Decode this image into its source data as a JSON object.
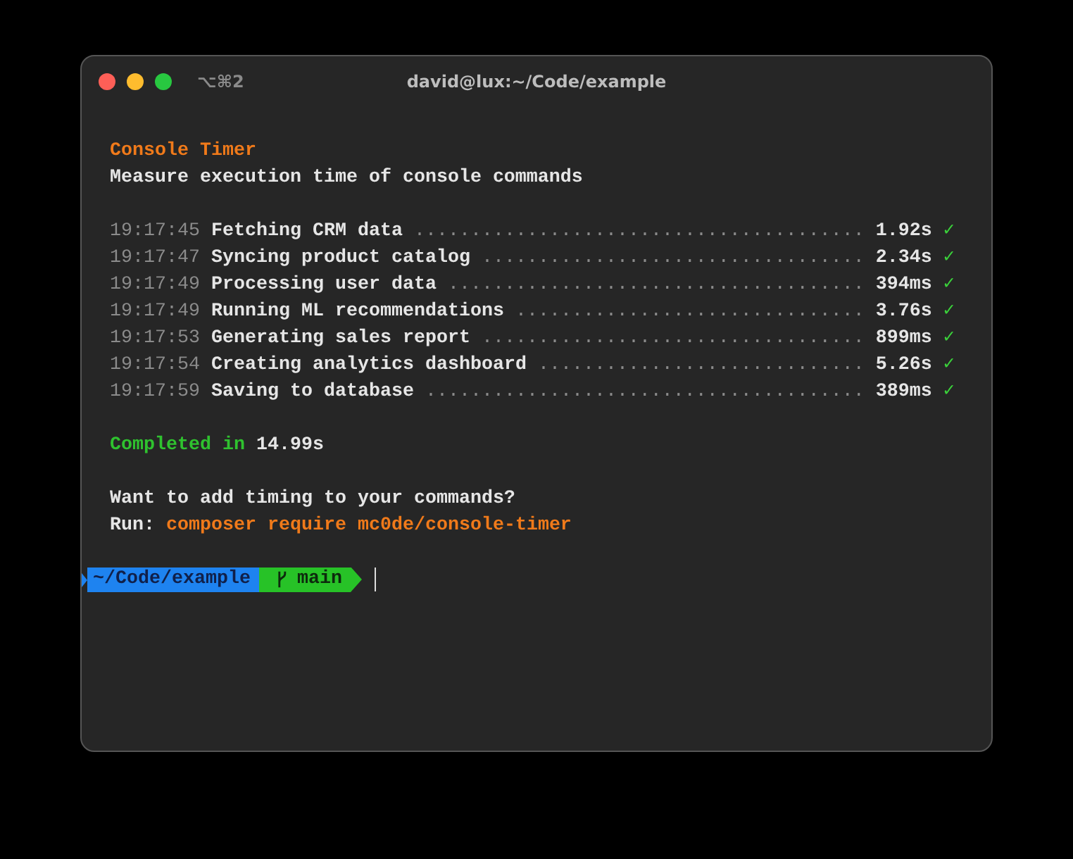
{
  "window": {
    "shortcut": "⌥⌘2",
    "title": "david@lux:~/Code/example"
  },
  "header": {
    "title": "Console Timer",
    "subtitle": "Measure execution time of console commands"
  },
  "tasks": [
    {
      "time": "19:17:45",
      "label": "Fetching CRM data",
      "leader": "........................................",
      "duration": "1.92s",
      "mark": "✓"
    },
    {
      "time": "19:17:47",
      "label": "Syncing product catalog",
      "leader": "..................................",
      "duration": "2.34s",
      "mark": "✓"
    },
    {
      "time": "19:17:49",
      "label": "Processing user data",
      "leader": ".....................................",
      "duration": "394ms",
      "mark": "✓"
    },
    {
      "time": "19:17:49",
      "label": "Running ML recommendations",
      "leader": "...............................",
      "duration": "3.76s",
      "mark": "✓"
    },
    {
      "time": "19:17:53",
      "label": "Generating sales report",
      "leader": "..................................",
      "duration": "899ms",
      "mark": "✓"
    },
    {
      "time": "19:17:54",
      "label": "Creating analytics dashboard",
      "leader": ".............................",
      "duration": "5.26s",
      "mark": "✓"
    },
    {
      "time": "19:17:59",
      "label": "Saving to database",
      "leader": ".......................................",
      "duration": "389ms",
      "mark": "✓"
    }
  ],
  "summary": {
    "label": "Completed in",
    "total": "14.99s"
  },
  "hint": {
    "question": "Want to add timing to your commands?",
    "run_label": "Run:",
    "command": "composer require mc0de/console-timer"
  },
  "prompt": {
    "path": "~/Code/example",
    "branch": "main"
  }
}
